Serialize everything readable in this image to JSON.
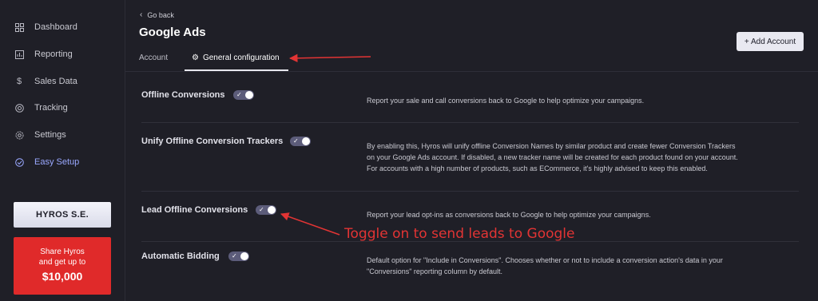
{
  "sidebar": {
    "items": [
      {
        "label": "Dashboard",
        "icon": "grid-icon"
      },
      {
        "label": "Reporting",
        "icon": "chart-icon"
      },
      {
        "label": "Sales Data",
        "icon": "dollar-icon"
      },
      {
        "label": "Tracking",
        "icon": "target-icon"
      },
      {
        "label": "Settings",
        "icon": "gear-icon"
      },
      {
        "label": "Easy Setup",
        "icon": "check-circle-icon"
      }
    ],
    "brand": "HYROS S.E.",
    "promo": {
      "line1": "Share Hyros",
      "line2": "and get up to",
      "amount": "$10,000"
    }
  },
  "header": {
    "back": "Go back",
    "title": "Google Ads",
    "add_account": "+ Add Account",
    "tabs": [
      {
        "label": "Account"
      },
      {
        "label": "General configuration"
      }
    ]
  },
  "settings": [
    {
      "label": "Offline Conversions",
      "enabled": true,
      "description": "Report your sale and call conversions back to Google to help optimize your campaigns."
    },
    {
      "label": "Unify Offline Conversion Trackers",
      "enabled": true,
      "description": "By enabling this, Hyros will unify offline Conversion Names by similar product and create fewer Conversion Trackers on your Google Ads account. If disabled, a new tracker name will be created for each product found on your account. For accounts with a high number of products, such as ECommerce, it's highly advised to keep this enabled."
    },
    {
      "label": "Lead Offline Conversions",
      "enabled": true,
      "description": "Report your lead opt-ins as conversions back to Google to help optimize your campaigns."
    },
    {
      "label": "Automatic Bidding",
      "enabled": true,
      "description": "Default option for \"Include in Conversions\". Chooses whether or not to include a conversion action's data in your \"Conversions\" reporting column by default."
    }
  ],
  "annotation": "Toggle on to send leads to Google",
  "colors": {
    "background": "#1f1f27",
    "accent": "#9aa8ff",
    "annotation": "#e23434",
    "promo": "#e02a2a"
  }
}
